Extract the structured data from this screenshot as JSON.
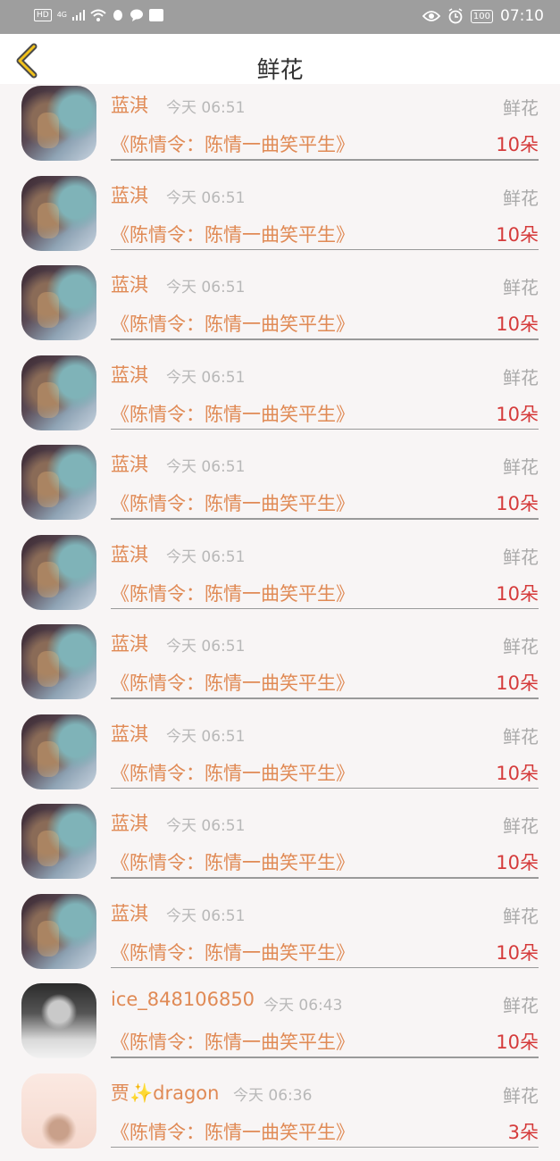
{
  "status_bar": {
    "hd": "HD",
    "network": "4G",
    "battery": "100",
    "time": "07:10"
  },
  "header": {
    "title": "鲜花"
  },
  "items": [
    {
      "name": "蓝淇",
      "time": "今天 06:51",
      "kind": "鲜花",
      "book": "《陈情令：陈情一曲笑平生》",
      "count": "10朵",
      "avatar": "dark"
    },
    {
      "name": "蓝淇",
      "time": "今天 06:51",
      "kind": "鲜花",
      "book": "《陈情令：陈情一曲笑平生》",
      "count": "10朵",
      "avatar": "dark"
    },
    {
      "name": "蓝淇",
      "time": "今天 06:51",
      "kind": "鲜花",
      "book": "《陈情令：陈情一曲笑平生》",
      "count": "10朵",
      "avatar": "dark"
    },
    {
      "name": "蓝淇",
      "time": "今天 06:51",
      "kind": "鲜花",
      "book": "《陈情令：陈情一曲笑平生》",
      "count": "10朵",
      "avatar": "dark"
    },
    {
      "name": "蓝淇",
      "time": "今天 06:51",
      "kind": "鲜花",
      "book": "《陈情令：陈情一曲笑平生》",
      "count": "10朵",
      "avatar": "dark"
    },
    {
      "name": "蓝淇",
      "time": "今天 06:51",
      "kind": "鲜花",
      "book": "《陈情令：陈情一曲笑平生》",
      "count": "10朵",
      "avatar": "dark"
    },
    {
      "name": "蓝淇",
      "time": "今天 06:51",
      "kind": "鲜花",
      "book": "《陈情令：陈情一曲笑平生》",
      "count": "10朵",
      "avatar": "dark"
    },
    {
      "name": "蓝淇",
      "time": "今天 06:51",
      "kind": "鲜花",
      "book": "《陈情令：陈情一曲笑平生》",
      "count": "10朵",
      "avatar": "dark"
    },
    {
      "name": "蓝淇",
      "time": "今天 06:51",
      "kind": "鲜花",
      "book": "《陈情令：陈情一曲笑平生》",
      "count": "10朵",
      "avatar": "dark"
    },
    {
      "name": "蓝淇",
      "time": "今天 06:51",
      "kind": "鲜花",
      "book": "《陈情令：陈情一曲笑平生》",
      "count": "10朵",
      "avatar": "dark"
    },
    {
      "name": "ice_848106850",
      "time": "今天 06:43",
      "kind": "鲜花",
      "book": "《陈情令：陈情一曲笑平生》",
      "count": "10朵",
      "avatar": "light"
    },
    {
      "name": "贾✨dragon",
      "time": "今天 06:36",
      "kind": "鲜花",
      "book": "《陈情令：陈情一曲笑平生》",
      "count": "3朵",
      "avatar": "pink"
    }
  ]
}
